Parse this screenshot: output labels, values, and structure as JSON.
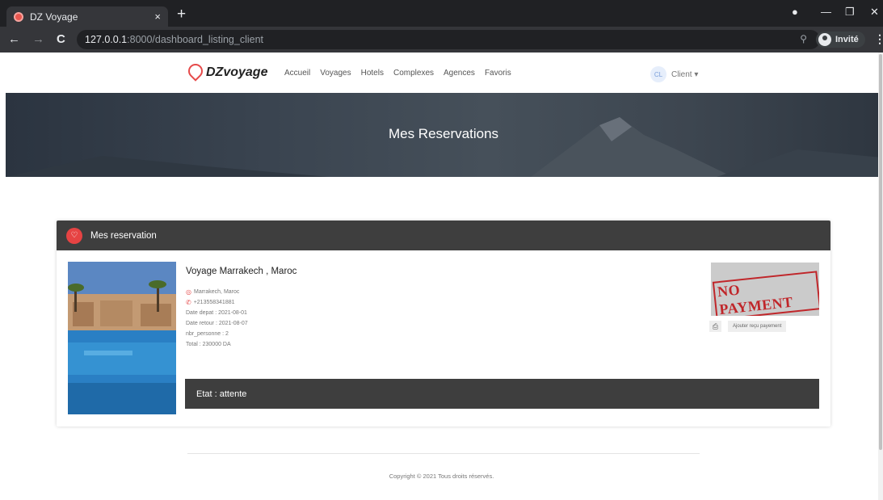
{
  "browser": {
    "tab_title": "DZ Voyage",
    "tab_close": "×",
    "new_tab": "+",
    "url_host": "127.0.0.1",
    "url_path": ":8000/dashboard_listing_client",
    "profile_label": "Invité"
  },
  "header": {
    "brand": "DZvoyage",
    "nav": [
      "Accueil",
      "Voyages",
      "Hotels",
      "Complexes",
      "Agences",
      "Favoris"
    ],
    "user_initials": "CL",
    "user_menu": "Client ▾"
  },
  "hero": {
    "title": "Mes Reservations"
  },
  "reservations": {
    "section_title": "Mes reservation",
    "item": {
      "title": "Voyage Marrakech , Maroc",
      "location": "Marrakech, Maroc",
      "phone": "+213558341881",
      "date_depart": "Date depat : 2021-08-01",
      "date_retour": "Date retour : 2021-08-07",
      "nbr_personne": "nbr_personne : 2",
      "total": "Total : 230000 DA",
      "status": "Etat : attente",
      "stamp": "NO PAYMENT",
      "receipt_button": "Ajouter reçu payement"
    }
  },
  "footer": {
    "copyright": "Copyright © 2021 Tous droits réservés."
  },
  "colors": {
    "accent": "#e64a4a",
    "dark_bar": "#3e3e3e"
  }
}
